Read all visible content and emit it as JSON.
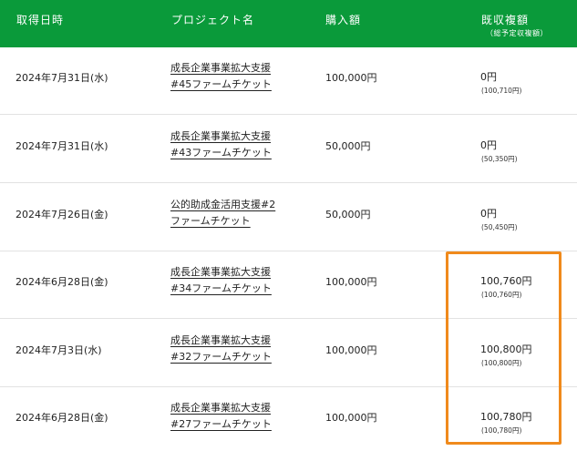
{
  "header": {
    "date": "取得日時",
    "project": "プロジェクト名",
    "amount": "購入額",
    "received": "既収複額",
    "received_sub": "（総予定収複額）"
  },
  "rows": [
    {
      "date": "2024年7月31日(水)",
      "project_line1": "成長企業事業拡大支援",
      "project_line2": "#45ファームチケット",
      "amount": "100,000円",
      "received": "0円",
      "received_total": "(100,710円)"
    },
    {
      "date": "2024年7月31日(水)",
      "project_line1": "成長企業事業拡大支援",
      "project_line2": "#43ファームチケット",
      "amount": "50,000円",
      "received": "0円",
      "received_total": "(50,350円)"
    },
    {
      "date": "2024年7月26日(金)",
      "project_line1": "公的助成金活用支援#2",
      "project_line2": "ファームチケット",
      "amount": "50,000円",
      "received": "0円",
      "received_total": "(50,450円)"
    },
    {
      "date": "2024年6月28日(金)",
      "project_line1": "成長企業事業拡大支援",
      "project_line2": "#34ファームチケット",
      "amount": "100,000円",
      "received": "100,760円",
      "received_total": "(100,760円)"
    },
    {
      "date": "2024年7月3日(水)",
      "project_line1": "成長企業事業拡大支援",
      "project_line2": "#32ファームチケット",
      "amount": "100,000円",
      "received": "100,800円",
      "received_total": "(100,800円)"
    },
    {
      "date": "2024年6月28日(金)",
      "project_line1": "成長企業事業拡大支援",
      "project_line2": "#27ファームチケット",
      "amount": "100,000円",
      "received": "100,780円",
      "received_total": "(100,780円)"
    }
  ],
  "colors": {
    "header_bg": "#0a9a3a",
    "highlight": "#f08a1c"
  }
}
